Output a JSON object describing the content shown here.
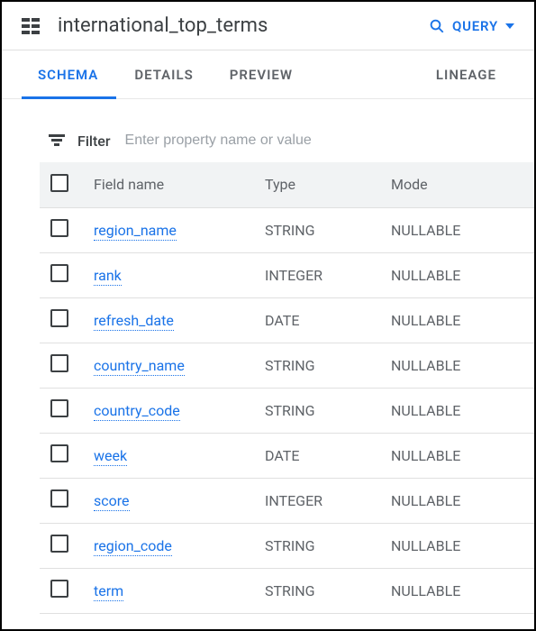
{
  "header": {
    "title": "international_top_terms",
    "query_label": "QUERY"
  },
  "tabs": [
    {
      "id": "schema",
      "label": "SCHEMA",
      "active": true
    },
    {
      "id": "details",
      "label": "DETAILS",
      "active": false
    },
    {
      "id": "preview",
      "label": "PREVIEW",
      "active": false
    },
    {
      "id": "lineage",
      "label": "LINEAGE",
      "active": false
    }
  ],
  "filter": {
    "label": "Filter",
    "placeholder": "Enter property name or value"
  },
  "columns": {
    "field_name": "Field name",
    "type": "Type",
    "mode": "Mode"
  },
  "rows": [
    {
      "field": "region_name",
      "type": "STRING",
      "mode": "NULLABLE"
    },
    {
      "field": "rank",
      "type": "INTEGER",
      "mode": "NULLABLE"
    },
    {
      "field": "refresh_date",
      "type": "DATE",
      "mode": "NULLABLE"
    },
    {
      "field": "country_name",
      "type": "STRING",
      "mode": "NULLABLE"
    },
    {
      "field": "country_code",
      "type": "STRING",
      "mode": "NULLABLE"
    },
    {
      "field": "week",
      "type": "DATE",
      "mode": "NULLABLE"
    },
    {
      "field": "score",
      "type": "INTEGER",
      "mode": "NULLABLE"
    },
    {
      "field": "region_code",
      "type": "STRING",
      "mode": "NULLABLE"
    },
    {
      "field": "term",
      "type": "STRING",
      "mode": "NULLABLE"
    }
  ]
}
